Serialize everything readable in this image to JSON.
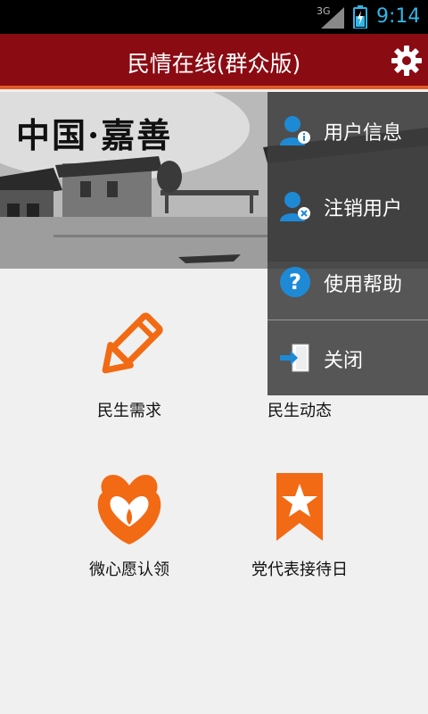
{
  "status_bar": {
    "network": "3G",
    "time": "9:14",
    "icons": [
      "signal-icon",
      "battery-charging-icon"
    ]
  },
  "header": {
    "title": "民情在线(群众版)",
    "settings_icon": "gear-icon",
    "background_color": "#8b0b13",
    "accent_color": "#e35a27"
  },
  "banner": {
    "calligraphy": "中国·嘉善"
  },
  "grid": [
    {
      "label": "民生需求",
      "icon": "pencil-icon"
    },
    {
      "label": "民生动态",
      "icon": "person-icon"
    },
    {
      "label": "微心愿认领",
      "icon": "hearts-icon"
    },
    {
      "label": "党代表接待日",
      "icon": "star-bookmark-icon"
    }
  ],
  "menu": {
    "items": [
      {
        "label": "用户信息",
        "icon": "user-info-icon"
      },
      {
        "label": "注销用户",
        "icon": "user-logout-icon"
      },
      {
        "label": "使用帮助",
        "icon": "help-icon"
      },
      {
        "label": "关闭",
        "icon": "exit-icon"
      }
    ]
  },
  "colors": {
    "icon_orange": "#f26a13",
    "menu_overlay": "#3c3c3c",
    "info_blue": "#1e8ad6"
  }
}
